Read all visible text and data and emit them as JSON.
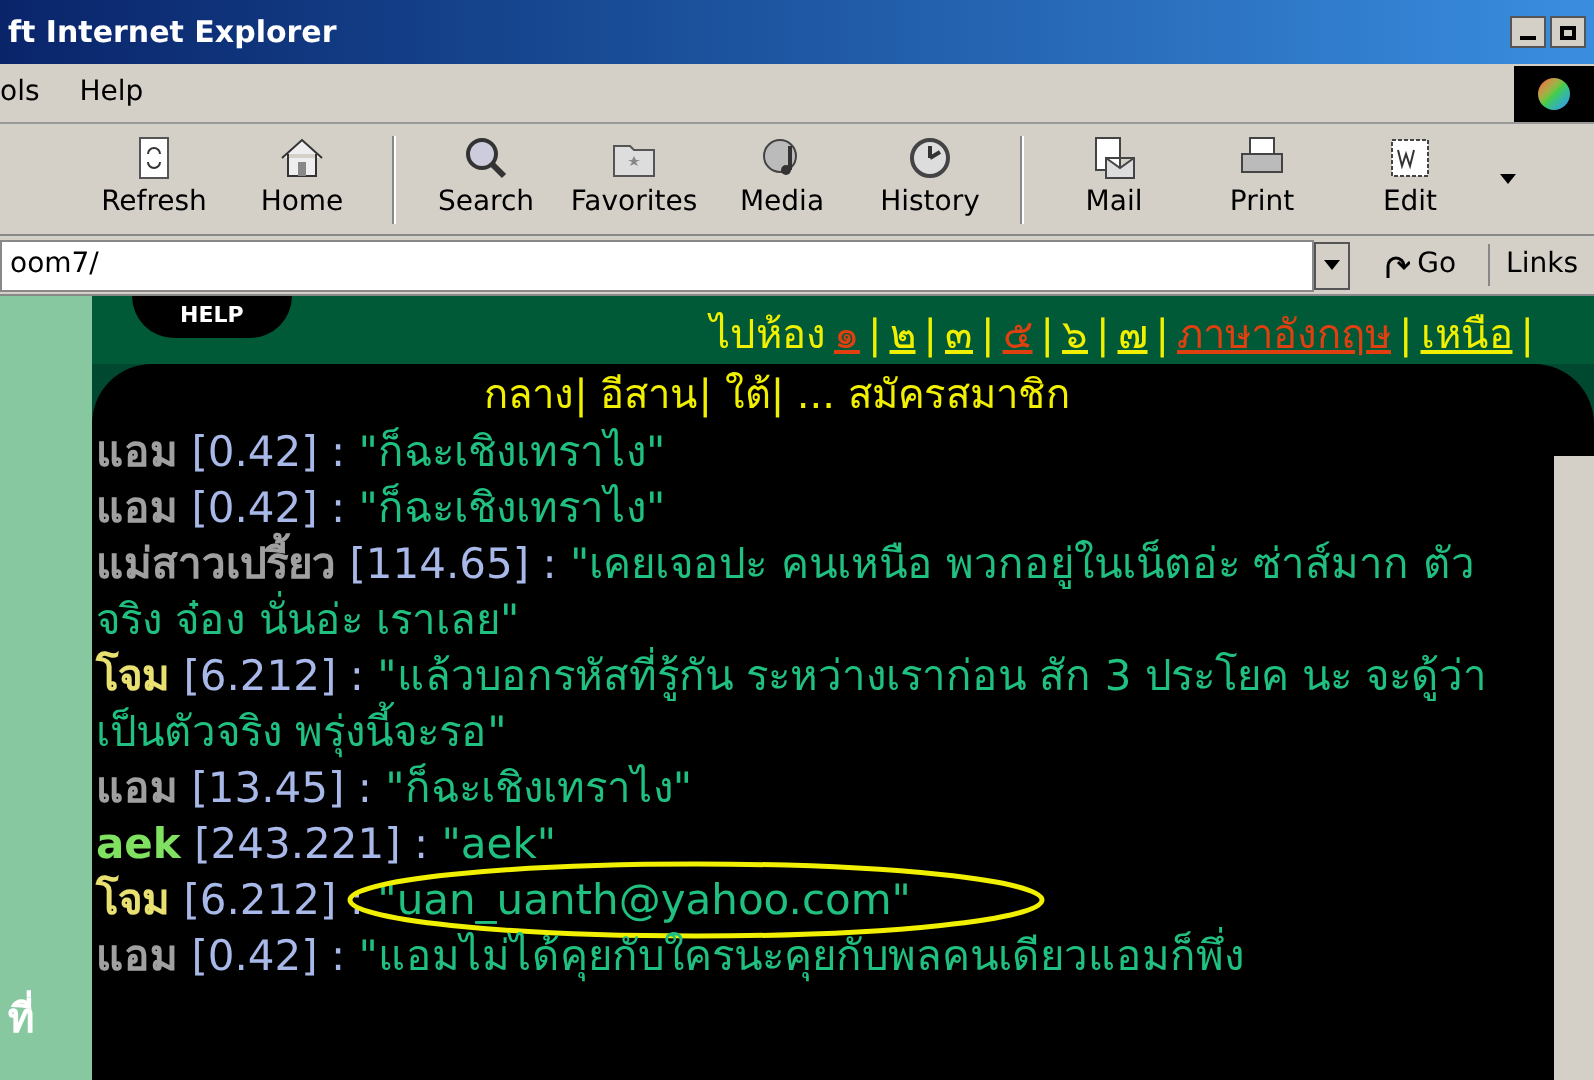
{
  "window": {
    "title": "ft Internet Explorer"
  },
  "menu": [
    "ols",
    "Help"
  ],
  "toolbar": [
    {
      "label": "Refresh",
      "kind": "refresh"
    },
    {
      "label": "Home",
      "kind": "home"
    },
    {
      "label": "Search",
      "kind": "search"
    },
    {
      "label": "Favorites",
      "kind": "favorites"
    },
    {
      "label": "Media",
      "kind": "media"
    },
    {
      "label": "History",
      "kind": "history"
    },
    {
      "label": "Mail",
      "kind": "mail"
    },
    {
      "label": "Print",
      "kind": "print"
    },
    {
      "label": "Edit",
      "kind": "edit"
    }
  ],
  "address": {
    "value": "oom7/",
    "go": "Go",
    "links": "Links"
  },
  "page": {
    "help": "HELP",
    "goto": "ไปห้อง",
    "rooms": [
      {
        "label": "๑",
        "separator": "|",
        "visited": true
      },
      {
        "label": "๒",
        "separator": "|",
        "visited": false
      },
      {
        "label": "๓",
        "separator": "|",
        "visited": false
      },
      {
        "label": "๕",
        "separator": "|",
        "visited": true
      },
      {
        "label": "๖",
        "separator": "|",
        "visited": false
      },
      {
        "label": "๗",
        "separator": "|",
        "visited": false
      },
      {
        "label": "ภาษาอังกฤษ",
        "separator": "|",
        "visited": true
      },
      {
        "label": "เหนือ",
        "separator": "|",
        "visited": false
      }
    ],
    "regions": "กลาง| อีสาน| ใต้| ... สมัครสมาชิก",
    "side_text": "ที่",
    "messages": [
      {
        "nick": "แอม",
        "color": "#a0a0a0",
        "ip": "[0.42]",
        "separator": ":",
        "text": "\"ก็ฉะเชิงเทราไง\"",
        "circled": false
      },
      {
        "nick": "แอม",
        "color": "#a0a0a0",
        "ip": "[0.42]",
        "separator": ":",
        "text": "\"ก็ฉะเชิงเทราไง\"",
        "circled": false
      },
      {
        "nick": "แม่สาวเปรี้ยว",
        "color": "#a0a0a0",
        "ip": "[114.65]",
        "separator": ":",
        "text": "\"เคยเจอปะ คนเหนือ พวกอยู่ในเน็ตอ่ะ ซ่าส์มาก ตัวจริง จ๋อง นั่นอ่ะ เราเลย\"",
        "circled": false
      },
      {
        "nick": "โจม",
        "color": "#e8e070",
        "ip": "[6.212]",
        "separator": ":",
        "text": "\"แล้วบอกรหัสที่รู้กัน ระหว่างเราก่อน สัก 3 ประโยค นะ จะดู้ว่าเป็นตัวจริง พรุ่งนี้จะรอ\"",
        "circled": false
      },
      {
        "nick": "แอม",
        "color": "#a0a0a0",
        "ip": "[13.45]",
        "separator": ":",
        "text": "\"ก็ฉะเชิงเทราไง\"",
        "circled": false
      },
      {
        "nick": "aek",
        "color": "#80e060",
        "ip": "[243.221]",
        "separator": ":",
        "text": "\"aek\"",
        "circled": false
      },
      {
        "nick": "โจม",
        "color": "#e8e070",
        "ip": "[6.212]",
        "separator": ":",
        "text": "\"uan_uanth@yahoo.com\"",
        "circled": true
      },
      {
        "nick": "แอม",
        "color": "#a0a0a0",
        "ip": "[0.42]",
        "separator": ":",
        "text": "\"แอมไม่ได้คุยกับใครนะคุยกับพลคนเดียวแอมก็พึ่ง",
        "circled": false
      }
    ]
  }
}
